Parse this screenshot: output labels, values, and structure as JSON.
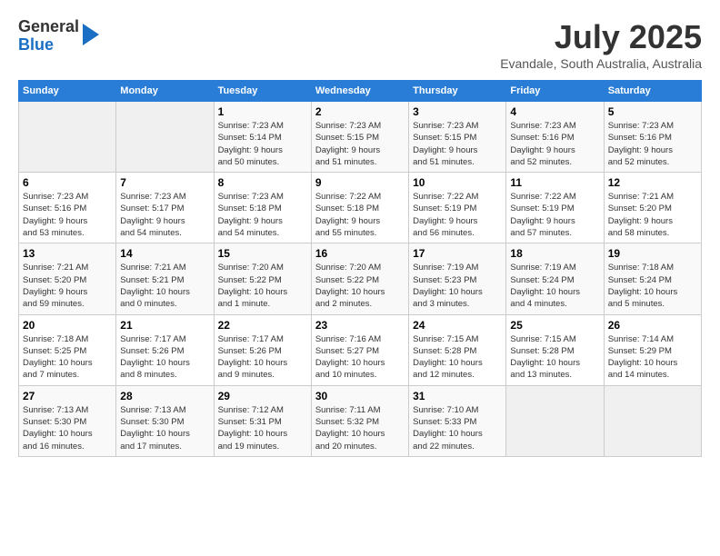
{
  "header": {
    "logo": {
      "general": "General",
      "blue": "Blue"
    },
    "title": "July 2025",
    "location": "Evandale, South Australia, Australia"
  },
  "calendar": {
    "days_of_week": [
      "Sunday",
      "Monday",
      "Tuesday",
      "Wednesday",
      "Thursday",
      "Friday",
      "Saturday"
    ],
    "weeks": [
      [
        {
          "day": "",
          "info": ""
        },
        {
          "day": "",
          "info": ""
        },
        {
          "day": "1",
          "info": "Sunrise: 7:23 AM\nSunset: 5:14 PM\nDaylight: 9 hours\nand 50 minutes."
        },
        {
          "day": "2",
          "info": "Sunrise: 7:23 AM\nSunset: 5:15 PM\nDaylight: 9 hours\nand 51 minutes."
        },
        {
          "day": "3",
          "info": "Sunrise: 7:23 AM\nSunset: 5:15 PM\nDaylight: 9 hours\nand 51 minutes."
        },
        {
          "day": "4",
          "info": "Sunrise: 7:23 AM\nSunset: 5:16 PM\nDaylight: 9 hours\nand 52 minutes."
        },
        {
          "day": "5",
          "info": "Sunrise: 7:23 AM\nSunset: 5:16 PM\nDaylight: 9 hours\nand 52 minutes."
        }
      ],
      [
        {
          "day": "6",
          "info": "Sunrise: 7:23 AM\nSunset: 5:16 PM\nDaylight: 9 hours\nand 53 minutes."
        },
        {
          "day": "7",
          "info": "Sunrise: 7:23 AM\nSunset: 5:17 PM\nDaylight: 9 hours\nand 54 minutes."
        },
        {
          "day": "8",
          "info": "Sunrise: 7:23 AM\nSunset: 5:18 PM\nDaylight: 9 hours\nand 54 minutes."
        },
        {
          "day": "9",
          "info": "Sunrise: 7:22 AM\nSunset: 5:18 PM\nDaylight: 9 hours\nand 55 minutes."
        },
        {
          "day": "10",
          "info": "Sunrise: 7:22 AM\nSunset: 5:19 PM\nDaylight: 9 hours\nand 56 minutes."
        },
        {
          "day": "11",
          "info": "Sunrise: 7:22 AM\nSunset: 5:19 PM\nDaylight: 9 hours\nand 57 minutes."
        },
        {
          "day": "12",
          "info": "Sunrise: 7:21 AM\nSunset: 5:20 PM\nDaylight: 9 hours\nand 58 minutes."
        }
      ],
      [
        {
          "day": "13",
          "info": "Sunrise: 7:21 AM\nSunset: 5:20 PM\nDaylight: 9 hours\nand 59 minutes."
        },
        {
          "day": "14",
          "info": "Sunrise: 7:21 AM\nSunset: 5:21 PM\nDaylight: 10 hours\nand 0 minutes."
        },
        {
          "day": "15",
          "info": "Sunrise: 7:20 AM\nSunset: 5:22 PM\nDaylight: 10 hours\nand 1 minute."
        },
        {
          "day": "16",
          "info": "Sunrise: 7:20 AM\nSunset: 5:22 PM\nDaylight: 10 hours\nand 2 minutes."
        },
        {
          "day": "17",
          "info": "Sunrise: 7:19 AM\nSunset: 5:23 PM\nDaylight: 10 hours\nand 3 minutes."
        },
        {
          "day": "18",
          "info": "Sunrise: 7:19 AM\nSunset: 5:24 PM\nDaylight: 10 hours\nand 4 minutes."
        },
        {
          "day": "19",
          "info": "Sunrise: 7:18 AM\nSunset: 5:24 PM\nDaylight: 10 hours\nand 5 minutes."
        }
      ],
      [
        {
          "day": "20",
          "info": "Sunrise: 7:18 AM\nSunset: 5:25 PM\nDaylight: 10 hours\nand 7 minutes."
        },
        {
          "day": "21",
          "info": "Sunrise: 7:17 AM\nSunset: 5:26 PM\nDaylight: 10 hours\nand 8 minutes."
        },
        {
          "day": "22",
          "info": "Sunrise: 7:17 AM\nSunset: 5:26 PM\nDaylight: 10 hours\nand 9 minutes."
        },
        {
          "day": "23",
          "info": "Sunrise: 7:16 AM\nSunset: 5:27 PM\nDaylight: 10 hours\nand 10 minutes."
        },
        {
          "day": "24",
          "info": "Sunrise: 7:15 AM\nSunset: 5:28 PM\nDaylight: 10 hours\nand 12 minutes."
        },
        {
          "day": "25",
          "info": "Sunrise: 7:15 AM\nSunset: 5:28 PM\nDaylight: 10 hours\nand 13 minutes."
        },
        {
          "day": "26",
          "info": "Sunrise: 7:14 AM\nSunset: 5:29 PM\nDaylight: 10 hours\nand 14 minutes."
        }
      ],
      [
        {
          "day": "27",
          "info": "Sunrise: 7:13 AM\nSunset: 5:30 PM\nDaylight: 10 hours\nand 16 minutes."
        },
        {
          "day": "28",
          "info": "Sunrise: 7:13 AM\nSunset: 5:30 PM\nDaylight: 10 hours\nand 17 minutes."
        },
        {
          "day": "29",
          "info": "Sunrise: 7:12 AM\nSunset: 5:31 PM\nDaylight: 10 hours\nand 19 minutes."
        },
        {
          "day": "30",
          "info": "Sunrise: 7:11 AM\nSunset: 5:32 PM\nDaylight: 10 hours\nand 20 minutes."
        },
        {
          "day": "31",
          "info": "Sunrise: 7:10 AM\nSunset: 5:33 PM\nDaylight: 10 hours\nand 22 minutes."
        },
        {
          "day": "",
          "info": ""
        },
        {
          "day": "",
          "info": ""
        }
      ]
    ]
  }
}
